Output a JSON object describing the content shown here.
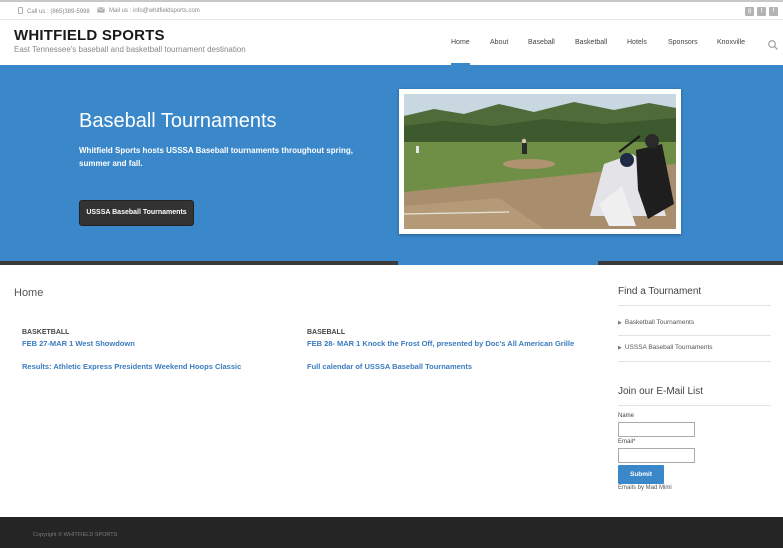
{
  "topbar": {
    "phone": "Call us : (865)389-5998",
    "mail": "Mail us : info@whitfieldsports.com",
    "social": [
      "google-plus-icon",
      "twitter-icon",
      "facebook-icon"
    ]
  },
  "header": {
    "title": "WHITFIELD SPORTS",
    "tagline": "East Tennessee's baseball and basketball tournament destination"
  },
  "nav": {
    "items": [
      "Home",
      "About",
      "Baseball",
      "Basketball",
      "Hotels",
      "Sponsors",
      "Knoxville"
    ],
    "active": "Home"
  },
  "hero": {
    "title": "Baseball Tournaments",
    "text": "Whitfield Sports hosts USSSA Baseball tournaments throughout spring, summer and fall.",
    "button": "USSSA Baseball Tournaments"
  },
  "main": {
    "page_title": "Home",
    "columns": [
      {
        "heading": "BASKETBALL",
        "links": [
          "FEB 27-MAR 1 West Showdown",
          "Results: Athletic Express Presidents Weekend Hoops Classic"
        ]
      },
      {
        "heading": "BASEBALL",
        "links": [
          "FEB 28- MAR 1 Knock the Frost Off, presented by Doc's All American Grille",
          "Full calendar of USSSA Baseball Tournaments"
        ]
      }
    ]
  },
  "sidebar": {
    "find_title": "Find a Tournament",
    "find_links": [
      "Basketball Tournaments",
      "USSSA Baseball Tournaments"
    ],
    "email_title": "Join our E-Mail List",
    "name_label": "Name",
    "email_label": "Email*",
    "submit": "Submit",
    "powered": "Emails by Mad Mimi"
  },
  "footer": {
    "copyright": "Copyright © WHITFIELD SPORTS"
  },
  "colors": {
    "accent": "#3a87c9",
    "link": "#3a7bbf",
    "footer": "#252525",
    "button_dark": "#333333"
  }
}
